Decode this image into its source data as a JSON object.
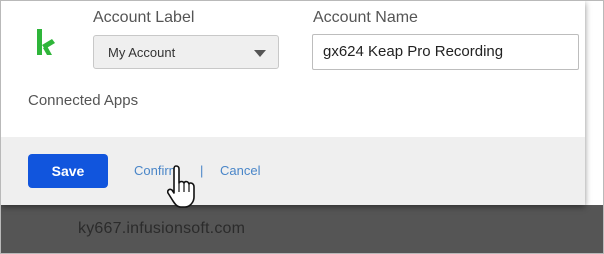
{
  "dialog": {
    "account_label_heading": "Account Label",
    "account_label_value": "My Account",
    "account_name_heading": "Account Name",
    "account_name_value": "gx624 Keap Pro Recording",
    "connected_apps_heading": "Connected Apps",
    "save_label": "Save",
    "confirm_label": "Confirm",
    "separator": "|",
    "cancel_label": "Cancel"
  },
  "background": {
    "url_text": "ky667.infusionsoft.com"
  },
  "icons": {
    "logo": "keap-logo-icon",
    "dropdown": "chevron-down-icon",
    "cursor": "hand-pointer-cursor-icon"
  },
  "colors": {
    "brand_green": "#2fb53a",
    "primary_button": "#1155dd",
    "link": "#4a86c8",
    "footer_bg": "#efefef",
    "backdrop": "#555555"
  }
}
